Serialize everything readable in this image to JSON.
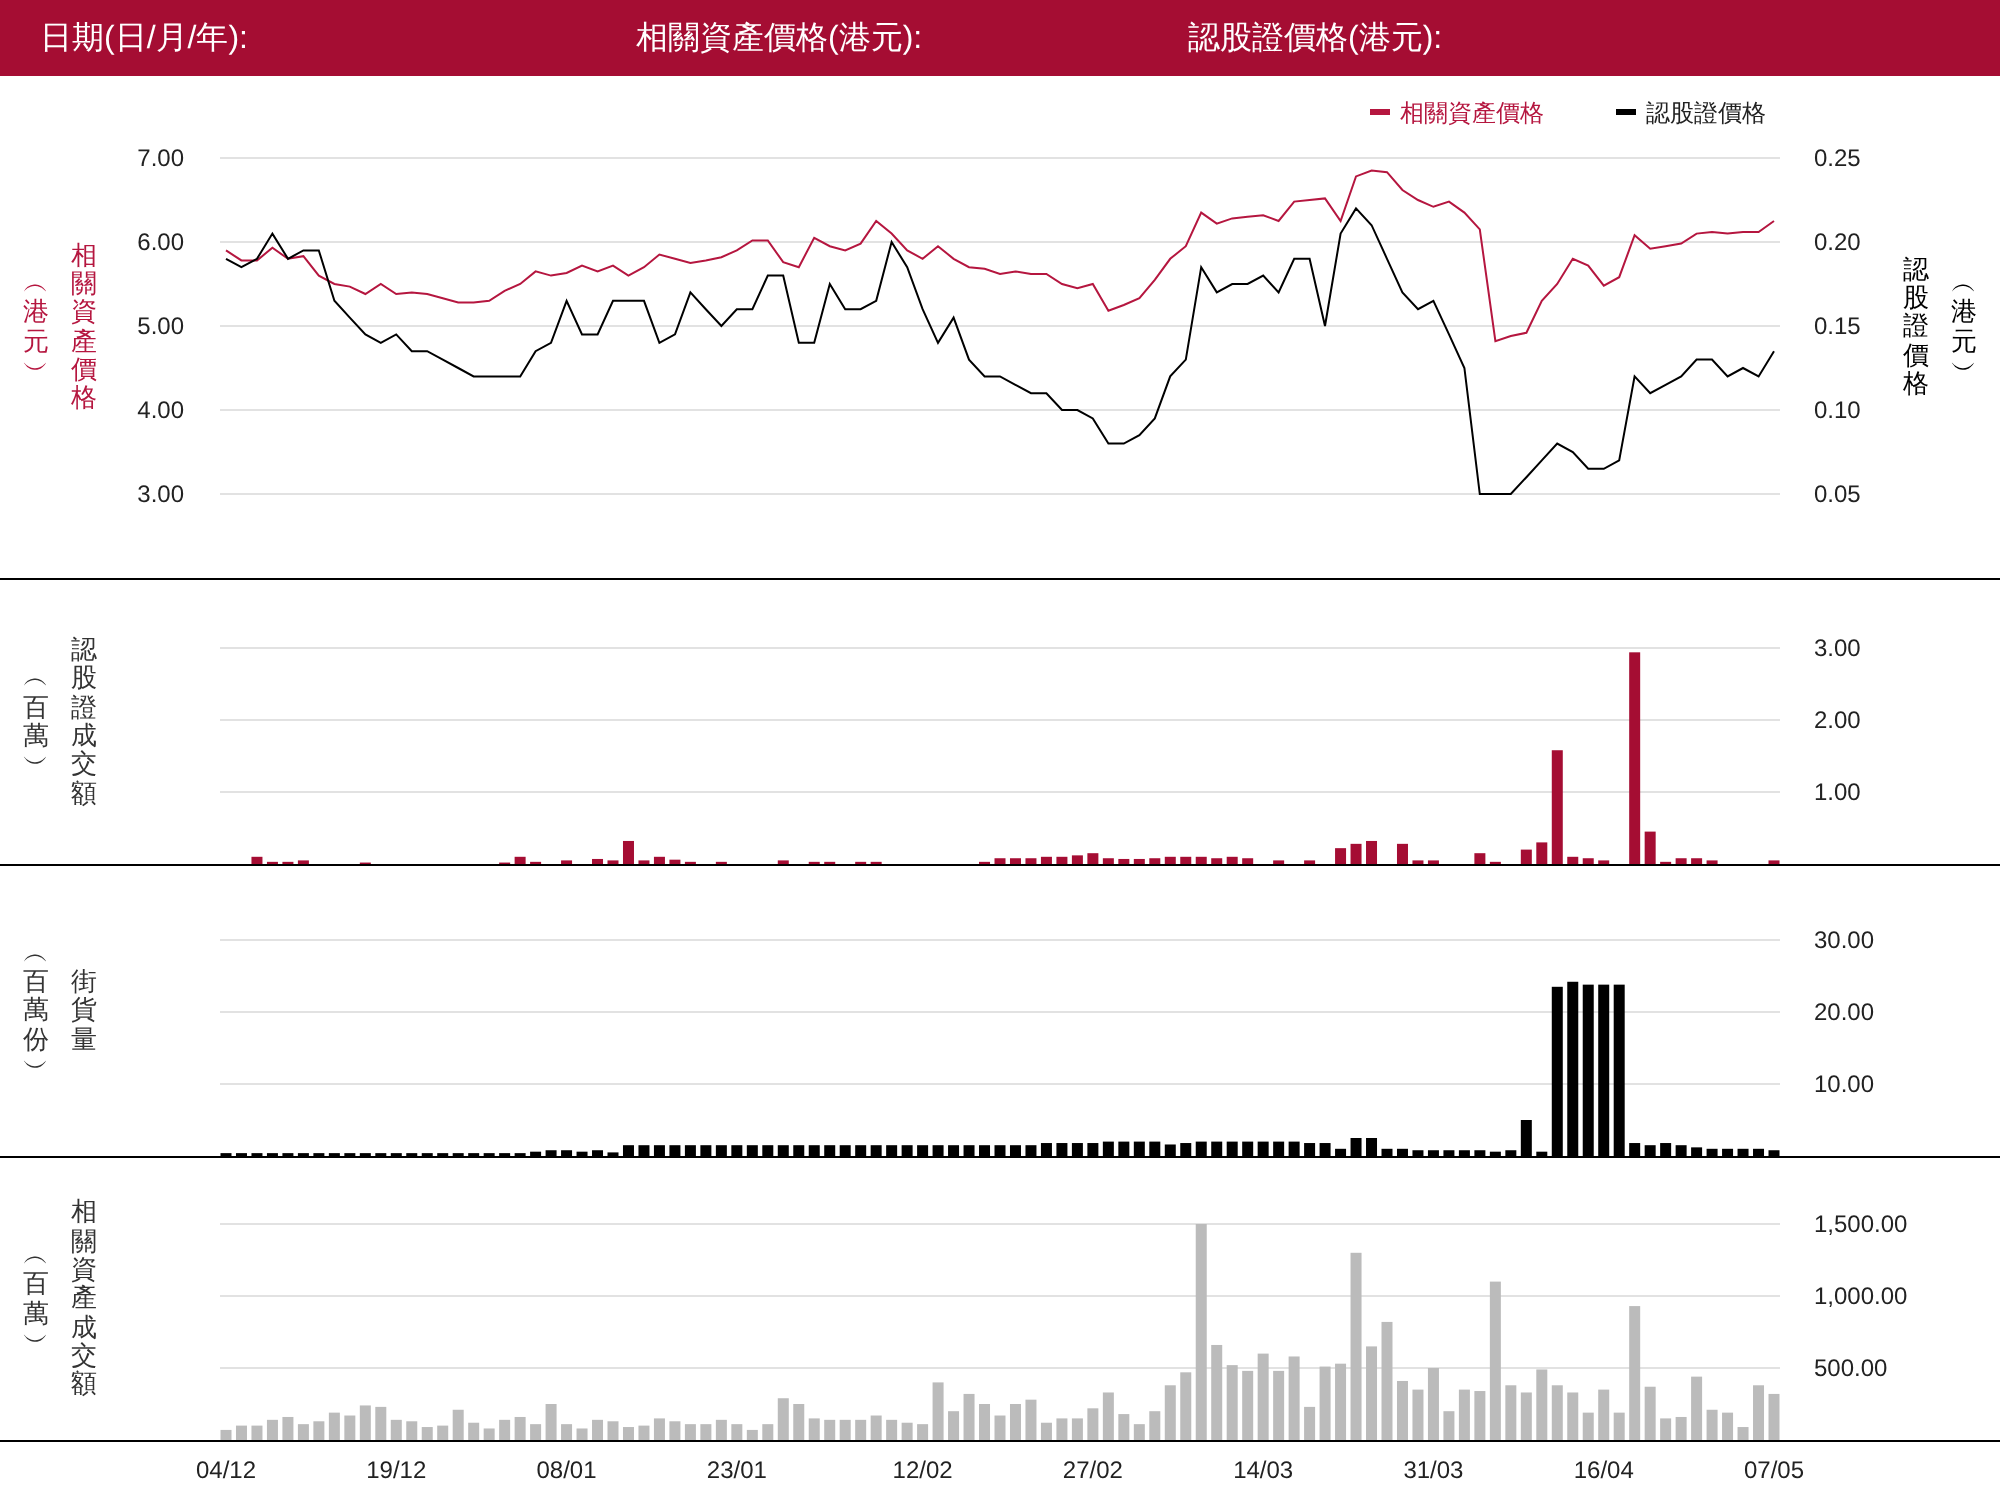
{
  "header": {
    "fields": [
      "日期(日/月/年):",
      "相關資產價格(港元):",
      "認股證價格(港元):"
    ]
  },
  "charts": [
    {
      "axis_titles": {
        "left": {
          "title": "相關資產價格",
          "unit": "︵港元︶"
        },
        "right": {
          "title": "認股證價格",
          "unit": "︵港元︶"
        }
      },
      "chart_data": {
        "type": "line",
        "grid": true,
        "legend": "top-right",
        "ylim": [
          3,
          7
        ],
        "yticks": [
          {
            "value": 3,
            "label": "3.00"
          },
          {
            "value": 4,
            "label": "4.00"
          },
          {
            "value": 5,
            "label": "5.00"
          },
          {
            "value": 6,
            "label": "6.00"
          },
          {
            "value": 7,
            "label": "7.00"
          }
        ],
        "y2lim": [
          0.05,
          0.25
        ],
        "y2ticks": [
          {
            "value": 0.05,
            "label": "0.05"
          },
          {
            "value": 0.1,
            "label": "0.10"
          },
          {
            "value": 0.15,
            "label": "0.15"
          },
          {
            "value": 0.2,
            "label": "0.20"
          },
          {
            "value": 0.25,
            "label": "0.25"
          }
        ],
        "series": [
          {
            "name": "相關資產價格",
            "color": "#b5163f",
            "values": [
              5.9,
              5.78,
              5.78,
              5.93,
              5.8,
              5.83,
              5.6,
              5.5,
              5.47,
              5.38,
              5.5,
              5.38,
              5.4,
              5.38,
              5.33,
              5.28,
              5.28,
              5.3,
              5.42,
              5.5,
              5.65,
              5.6,
              5.63,
              5.72,
              5.65,
              5.72,
              5.6,
              5.7,
              5.85,
              5.8,
              5.75,
              5.78,
              5.82,
              5.9,
              6.02,
              6.02,
              5.76,
              5.7,
              6.05,
              5.95,
              5.9,
              5.98,
              6.25,
              6.1,
              5.9,
              5.8,
              5.95,
              5.8,
              5.7,
              5.68,
              5.62,
              5.65,
              5.62,
              5.62,
              5.5,
              5.45,
              5.5,
              5.18,
              5.25,
              5.33,
              5.55,
              5.8,
              5.95,
              6.35,
              6.22,
              6.28,
              6.3,
              6.32,
              6.25,
              6.48,
              6.5,
              6.52,
              6.25,
              6.78,
              6.85,
              6.83,
              6.62,
              6.5,
              6.42,
              6.48,
              6.35,
              6.15,
              4.82,
              4.88,
              4.92,
              5.3,
              5.5,
              5.8,
              5.72,
              5.48,
              5.58,
              6.08,
              5.92,
              5.95,
              5.98,
              6.1,
              6.12,
              6.1,
              6.12,
              6.12,
              6.25
            ]
          },
          {
            "name": "認股證價格",
            "color": "#000000",
            "axis": "y2",
            "values": [
              0.19,
              0.185,
              0.19,
              0.205,
              0.19,
              0.195,
              0.195,
              0.165,
              0.155,
              0.145,
              0.14,
              0.145,
              0.135,
              0.135,
              0.13,
              0.125,
              0.12,
              0.12,
              0.12,
              0.12,
              0.135,
              0.14,
              0.165,
              0.145,
              0.145,
              0.165,
              0.165,
              0.165,
              0.14,
              0.145,
              0.17,
              0.16,
              0.15,
              0.16,
              0.16,
              0.18,
              0.18,
              0.14,
              0.14,
              0.175,
              0.16,
              0.16,
              0.165,
              0.2,
              0.185,
              0.16,
              0.14,
              0.155,
              0.13,
              0.12,
              0.12,
              0.115,
              0.11,
              0.11,
              0.1,
              0.1,
              0.095,
              0.08,
              0.08,
              0.085,
              0.095,
              0.12,
              0.13,
              0.185,
              0.17,
              0.175,
              0.175,
              0.18,
              0.17,
              0.19,
              0.19,
              0.15,
              0.205,
              0.22,
              0.21,
              0.19,
              0.17,
              0.16,
              0.165,
              0.145,
              0.125,
              0.05,
              0.05,
              0.05,
              0.06,
              0.07,
              0.08,
              0.075,
              0.065,
              0.065,
              0.07,
              0.12,
              0.11,
              0.115,
              0.12,
              0.13,
              0.13,
              0.12,
              0.125,
              0.12,
              0.135
            ]
          }
        ]
      }
    },
    {
      "axis_titles": {
        "left": {
          "title": "認股證成交額",
          "unit": "︵百萬︶"
        }
      },
      "chart_data": {
        "type": "bar",
        "grid": true,
        "ylim": [
          0,
          3
        ],
        "yticks": [
          {
            "value": 1,
            "label": "1.00"
          },
          {
            "value": 2,
            "label": "2.00"
          },
          {
            "value": 3,
            "label": "3.00"
          }
        ],
        "series": [
          {
            "color": "#a50d33",
            "values": [
              0,
              0,
              0.1,
              0.03,
              0.03,
              0.05,
              0,
              0,
              0,
              0.02,
              0,
              0,
              0,
              0,
              0,
              0,
              0,
              0,
              0.02,
              0.1,
              0.03,
              0,
              0.05,
              0,
              0.07,
              0.05,
              0.32,
              0.05,
              0.1,
              0.06,
              0.03,
              0,
              0.03,
              0,
              0,
              0,
              0.05,
              0,
              0.03,
              0.03,
              0,
              0.03,
              0.03,
              0,
              0,
              0,
              0,
              0,
              0,
              0.03,
              0.08,
              0.08,
              0.08,
              0.1,
              0.1,
              0.12,
              0.15,
              0.08,
              0.07,
              0.07,
              0.08,
              0.1,
              0.1,
              0.1,
              0.08,
              0.1,
              0.08,
              0,
              0.05,
              0,
              0.05,
              0,
              0.22,
              0.28,
              0.32,
              0,
              0.28,
              0.05,
              0.05,
              0,
              0,
              0.15,
              0.03,
              0,
              0.2,
              0.3,
              1.58,
              0.1,
              0.08,
              0.05,
              0,
              2.94,
              0.45,
              0.03,
              0.08,
              0.08,
              0.05,
              0,
              0,
              0,
              0.05
            ]
          }
        ]
      }
    },
    {
      "axis_titles": {
        "left": {
          "title": "街貨量",
          "unit": "︵百萬份︶"
        }
      },
      "chart_data": {
        "type": "bar",
        "grid": true,
        "ylim": [
          0,
          30
        ],
        "yticks": [
          {
            "value": 10,
            "label": "10.00"
          },
          {
            "value": 20,
            "label": "20.00"
          },
          {
            "value": 30,
            "label": "30.00"
          }
        ],
        "series": [
          {
            "color": "#000000",
            "values": [
              0.4,
              0.4,
              0.4,
              0.4,
              0.4,
              0.4,
              0.4,
              0.4,
              0.4,
              0.4,
              0.4,
              0.4,
              0.4,
              0.4,
              0.4,
              0.4,
              0.4,
              0.4,
              0.4,
              0.4,
              0.6,
              0.8,
              0.8,
              0.6,
              0.8,
              0.5,
              1.5,
              1.5,
              1.5,
              1.5,
              1.5,
              1.5,
              1.5,
              1.5,
              1.5,
              1.5,
              1.5,
              1.5,
              1.5,
              1.5,
              1.5,
              1.5,
              1.5,
              1.5,
              1.5,
              1.5,
              1.5,
              1.5,
              1.5,
              1.5,
              1.5,
              1.5,
              1.5,
              1.8,
              1.8,
              1.8,
              1.8,
              2.0,
              2.0,
              2.0,
              2.0,
              1.6,
              1.8,
              2.0,
              2.0,
              2.0,
              2.0,
              2.0,
              2.0,
              2.0,
              1.8,
              1.8,
              1.0,
              2.5,
              2.5,
              1.0,
              1.0,
              0.8,
              0.8,
              0.8,
              0.8,
              0.8,
              0.6,
              0.8,
              5.0,
              0.6,
              23.5,
              24.2,
              23.8,
              23.8,
              23.8,
              1.8,
              1.5,
              1.8,
              1.5,
              1.2,
              1.0,
              1.0,
              1.0,
              1.0,
              0.8
            ]
          }
        ]
      }
    },
    {
      "axis_titles": {
        "left": {
          "title": "相關資產成交額",
          "unit": "︵百萬︶"
        }
      },
      "chart_data": {
        "type": "bar",
        "grid": true,
        "ylim": [
          0,
          1500
        ],
        "yticks": [
          {
            "value": 500,
            "label": "500.00"
          },
          {
            "value": 1000,
            "label": "1,000.00"
          },
          {
            "value": 1500,
            "label": "1,500.00"
          }
        ],
        "categories": [
          "04/12",
          null,
          null,
          null,
          null,
          null,
          null,
          null,
          null,
          null,
          null,
          "19/12",
          null,
          null,
          null,
          null,
          null,
          null,
          null,
          null,
          null,
          null,
          "08/01",
          null,
          null,
          null,
          null,
          null,
          null,
          null,
          null,
          null,
          null,
          "23/01",
          null,
          null,
          null,
          null,
          null,
          null,
          null,
          null,
          null,
          null,
          null,
          "12/02",
          null,
          null,
          null,
          null,
          null,
          null,
          null,
          null,
          null,
          null,
          "27/02",
          null,
          null,
          null,
          null,
          null,
          null,
          null,
          null,
          null,
          null,
          "14/03",
          null,
          null,
          null,
          null,
          null,
          null,
          null,
          null,
          null,
          null,
          "31/03",
          null,
          null,
          null,
          null,
          null,
          null,
          null,
          null,
          null,
          null,
          "16/04",
          null,
          null,
          null,
          null,
          null,
          null,
          null,
          null,
          null,
          null,
          "07/05"
        ],
        "series": [
          {
            "color": "#bbbbbb",
            "values": [
              70,
              100,
              100,
              140,
              160,
              110,
              130,
              190,
              170,
              240,
              230,
              140,
              130,
              90,
              100,
              210,
              120,
              80,
              140,
              160,
              110,
              250,
              110,
              80,
              140,
              130,
              90,
              100,
              150,
              130,
              110,
              110,
              140,
              110,
              70,
              110,
              290,
              250,
              150,
              140,
              140,
              140,
              170,
              140,
              120,
              110,
              400,
              200,
              320,
              250,
              170,
              250,
              280,
              120,
              150,
              150,
              220,
              330,
              180,
              110,
              200,
              380,
              470,
              1500,
              660,
              520,
              480,
              600,
              480,
              580,
              230,
              510,
              530,
              1300,
              650,
              820,
              410,
              350,
              500,
              200,
              350,
              340,
              1100,
              380,
              330,
              490,
              380,
              330,
              190,
              350,
              190,
              930,
              370,
              150,
              160,
              440,
              210,
              190,
              90,
              380,
              320
            ]
          }
        ]
      }
    }
  ]
}
